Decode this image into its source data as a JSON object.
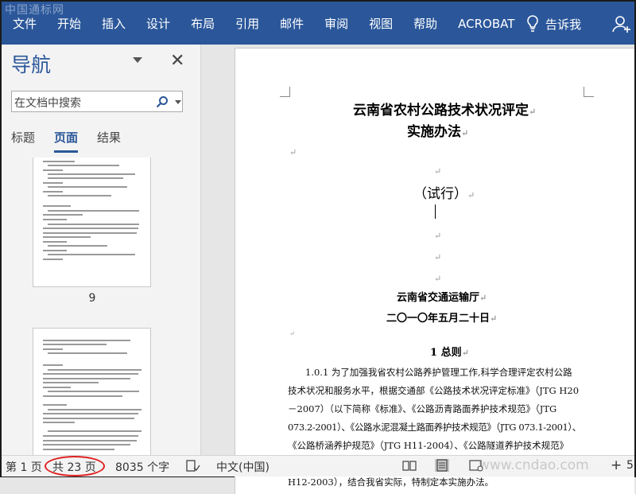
{
  "watermark": "中国通标网",
  "ribbon": {
    "tabs": [
      "文件",
      "开始",
      "插入",
      "设计",
      "布局",
      "引用",
      "邮件",
      "审阅",
      "视图",
      "帮助",
      "ACROBAT"
    ],
    "tell_me": "告诉我",
    "bg_color": "#2b579a"
  },
  "nav": {
    "title": "导航",
    "search_placeholder": "在文档中搜索",
    "tabs": [
      "标题",
      "页面",
      "结果"
    ],
    "active_tab": "页面",
    "page_label": "9"
  },
  "doc": {
    "title1": "云南省农村公路技术状况评定",
    "title2": "实施办法",
    "trial": "（试行）",
    "issuer": "云南省交通运输厅",
    "date": "二〇一〇年五月二十日",
    "section": "1  总则",
    "para_lines": [
      "1.0.1 为了加强我省农村公路养护管理工作,科学合理评定农村公路",
      "技术状况和服务水平，根据交通部《公路技术状况评定标准》（JTG H20",
      "－2007）（以下简称《标准》、《公路沥青路面养护技术规范》（JTG",
      "073.2-2001）、《公路水泥混凝土路面养护技术规范》（JTG 073.1-2001）、",
      "《公路桥涵养护规范》（JTG H11-2004）、《公路隧道养护技术规范》（JTG",
      "H12-2003），结合我省实际，特制定本实施办法。"
    ]
  },
  "status": {
    "page": "第 1 页",
    "total": "共 23 页",
    "words": "8035 个字",
    "language": "中文(中国)",
    "site": "www.cndao.com",
    "zoom_plus": "+",
    "zoom_tail": "5"
  }
}
